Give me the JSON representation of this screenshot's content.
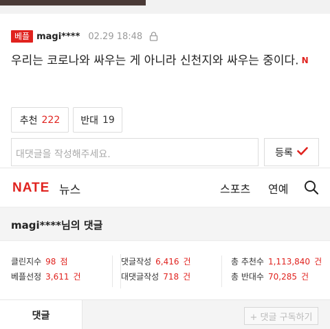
{
  "comment": {
    "badge": "베플",
    "author": "magi****",
    "date": "02.29 18:48",
    "text": "우리는 코로나와 싸우는 게 아니라 신천지와 싸우는 중이다.",
    "new_mark": "N",
    "upvote_label": "추천",
    "upvote_count": "222",
    "downvote_label": "반대",
    "downvote_count": "19",
    "reply_placeholder": "대댓글을 작성해주세요.",
    "submit_label": "등록"
  },
  "header": {
    "logo": "NATE",
    "section": "뉴스",
    "nav": [
      "스포츠",
      "연예"
    ]
  },
  "profile": {
    "title": "magi****님의 댓글"
  },
  "stats": {
    "clean_label": "클린지수",
    "clean_value": "98",
    "clean_unit": "점",
    "best_label": "베플선정",
    "best_value": "3,611",
    "best_unit": "건",
    "written_label": "댓글작성",
    "written_value": "6,416",
    "written_unit": "건",
    "reply_label": "대댓글작성",
    "reply_value": "718",
    "reply_unit": "건",
    "total_up_label": "총 추천수",
    "total_up_value": "1,113,840",
    "total_up_unit": "건",
    "total_down_label": "총 반대수",
    "total_down_value": "70,285",
    "total_down_unit": "건"
  },
  "tabs": {
    "active": "댓글",
    "subscribe": "+ 댓글 구독하기"
  },
  "colors": {
    "accent": "#e0221e"
  },
  "icons": {
    "lock": "lock-icon",
    "check": "check-icon",
    "search": "search-icon"
  }
}
